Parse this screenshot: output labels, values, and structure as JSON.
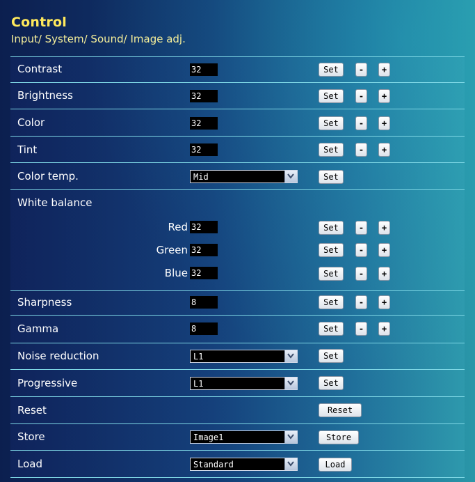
{
  "header": {
    "title": "Control",
    "subtitle": "Input/ System/ Sound/ Image adj."
  },
  "buttons": {
    "set": "Set",
    "minus": "-",
    "plus": "+"
  },
  "rows": {
    "contrast": {
      "label": "Contrast",
      "value": "32"
    },
    "brightness": {
      "label": "Brightness",
      "value": "32"
    },
    "color": {
      "label": "Color",
      "value": "32"
    },
    "tint": {
      "label": "Tint",
      "value": "32"
    },
    "color_temp": {
      "label": "Color temp.",
      "selected": "Mid"
    },
    "white_balance": {
      "label": "White balance",
      "red": {
        "label": "Red",
        "value": "32"
      },
      "green": {
        "label": "Green",
        "value": "32"
      },
      "blue": {
        "label": "Blue",
        "value": "32"
      }
    },
    "sharpness": {
      "label": "Sharpness",
      "value": "8"
    },
    "gamma": {
      "label": "Gamma",
      "value": "8"
    },
    "noise_reduction": {
      "label": "Noise reduction",
      "selected": "L1"
    },
    "progressive": {
      "label": "Progressive",
      "selected": "L1"
    },
    "reset": {
      "label": "Reset",
      "button": "Reset"
    },
    "store": {
      "label": "Store",
      "selected": "Image1",
      "button": "Store"
    },
    "load": {
      "label": "Load",
      "selected": "Standard",
      "button": "Load"
    }
  },
  "icons": {
    "dropdown": "chevron-down-icon"
  },
  "colors": {
    "title": "#ffe95c",
    "row_border": "#7fd8e6",
    "value_bg": "#000000"
  }
}
